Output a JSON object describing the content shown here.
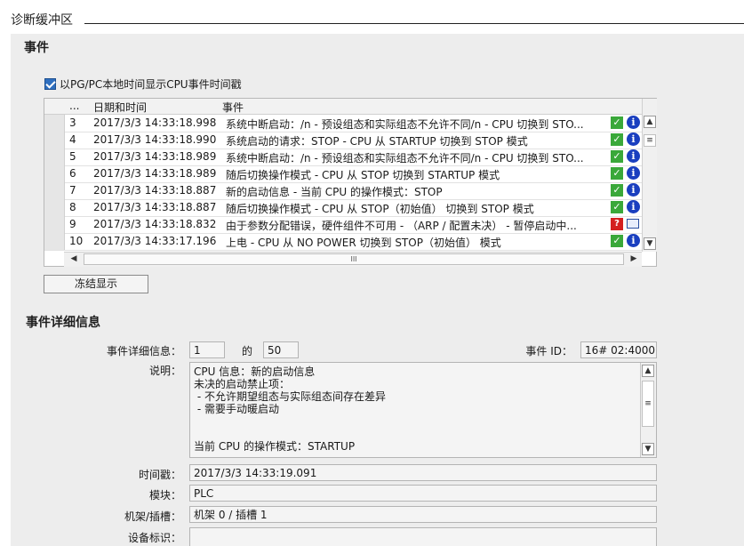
{
  "window": {
    "title": "诊断缓冲区"
  },
  "events_section": {
    "title": "事件",
    "checkbox_label": "以PG/PC本地时间显示CPU事件时间戳",
    "columns": [
      "...",
      "日期和时间",
      "事件"
    ],
    "rows": [
      {
        "no": "3",
        "datetime": "2017/3/3 14:33:18.998",
        "event": "系统中断启动：/n - 预设组态和实际组态不允许不同/n - CPU 切换到 STO...",
        "status": "ok"
      },
      {
        "no": "4",
        "datetime": "2017/3/3 14:33:18.990",
        "event": "系统启动的请求：STOP - CPU 从 STARTUP 切换到 STOP 模式",
        "status": "ok"
      },
      {
        "no": "5",
        "datetime": "2017/3/3 14:33:18.989",
        "event": "系统中断启动：/n - 预设组态和实际组态不允许不同/n - CPU 切换到 STO...",
        "status": "ok"
      },
      {
        "no": "6",
        "datetime": "2017/3/3 14:33:18.989",
        "event": "随后切换操作模式 - CPU 从 STOP 切换到 STARTUP 模式",
        "status": "ok"
      },
      {
        "no": "7",
        "datetime": "2017/3/3 14:33:18.887",
        "event": "新的启动信息 - 当前 CPU 的操作模式：STOP",
        "status": "ok"
      },
      {
        "no": "8",
        "datetime": "2017/3/3 14:33:18.887",
        "event": "随后切换操作模式 - CPU 从 STOP（初始值） 切换到 STOP 模式",
        "status": "ok"
      },
      {
        "no": "9",
        "datetime": "2017/3/3 14:33:18.832",
        "event": "由于参数分配错误，硬件组件不可用 - （ARP / 配置未决） - 暂停启动中...",
        "status": "error"
      },
      {
        "no": "10",
        "datetime": "2017/3/3 14:33:17.196",
        "event": "上电 - CPU 从 NO POWER 切换到 STOP（初始值） 模式",
        "status": "ok"
      }
    ],
    "hscroll_thumb": "III",
    "freeze_button": "冻结显示"
  },
  "details_section": {
    "title": "事件详细信息",
    "detail_label": "事件详细信息：",
    "detail_index": "1",
    "of_label": "的",
    "detail_total": "50",
    "event_id_label": "事件 ID：",
    "event_id": "16# 02:4000",
    "desc_label": "说明：",
    "desc_lines": [
      "CPU 信息：新的启动信息",
      "未决的启动禁止项：",
      " - 不允许期望组态与实际组态间存在差异",
      " - 需要手动暖启动",
      "",
      "",
      "当前 CPU 的操作模式：STARTUP"
    ],
    "timestamp_label": "时间戳：",
    "timestamp": "2017/3/3 14:33:19.091",
    "module_label": "模块：",
    "module": "PLC",
    "rack_slot_label": "机架/插槽：",
    "rack_slot": "机架 0 / 插槽 1",
    "device_id_label": "设备标识：",
    "device_id": ""
  },
  "colors": {
    "ok": "#3aa83a",
    "info": "#1a3fbf",
    "error": "#d42020",
    "panel_bg": "#ededed"
  }
}
